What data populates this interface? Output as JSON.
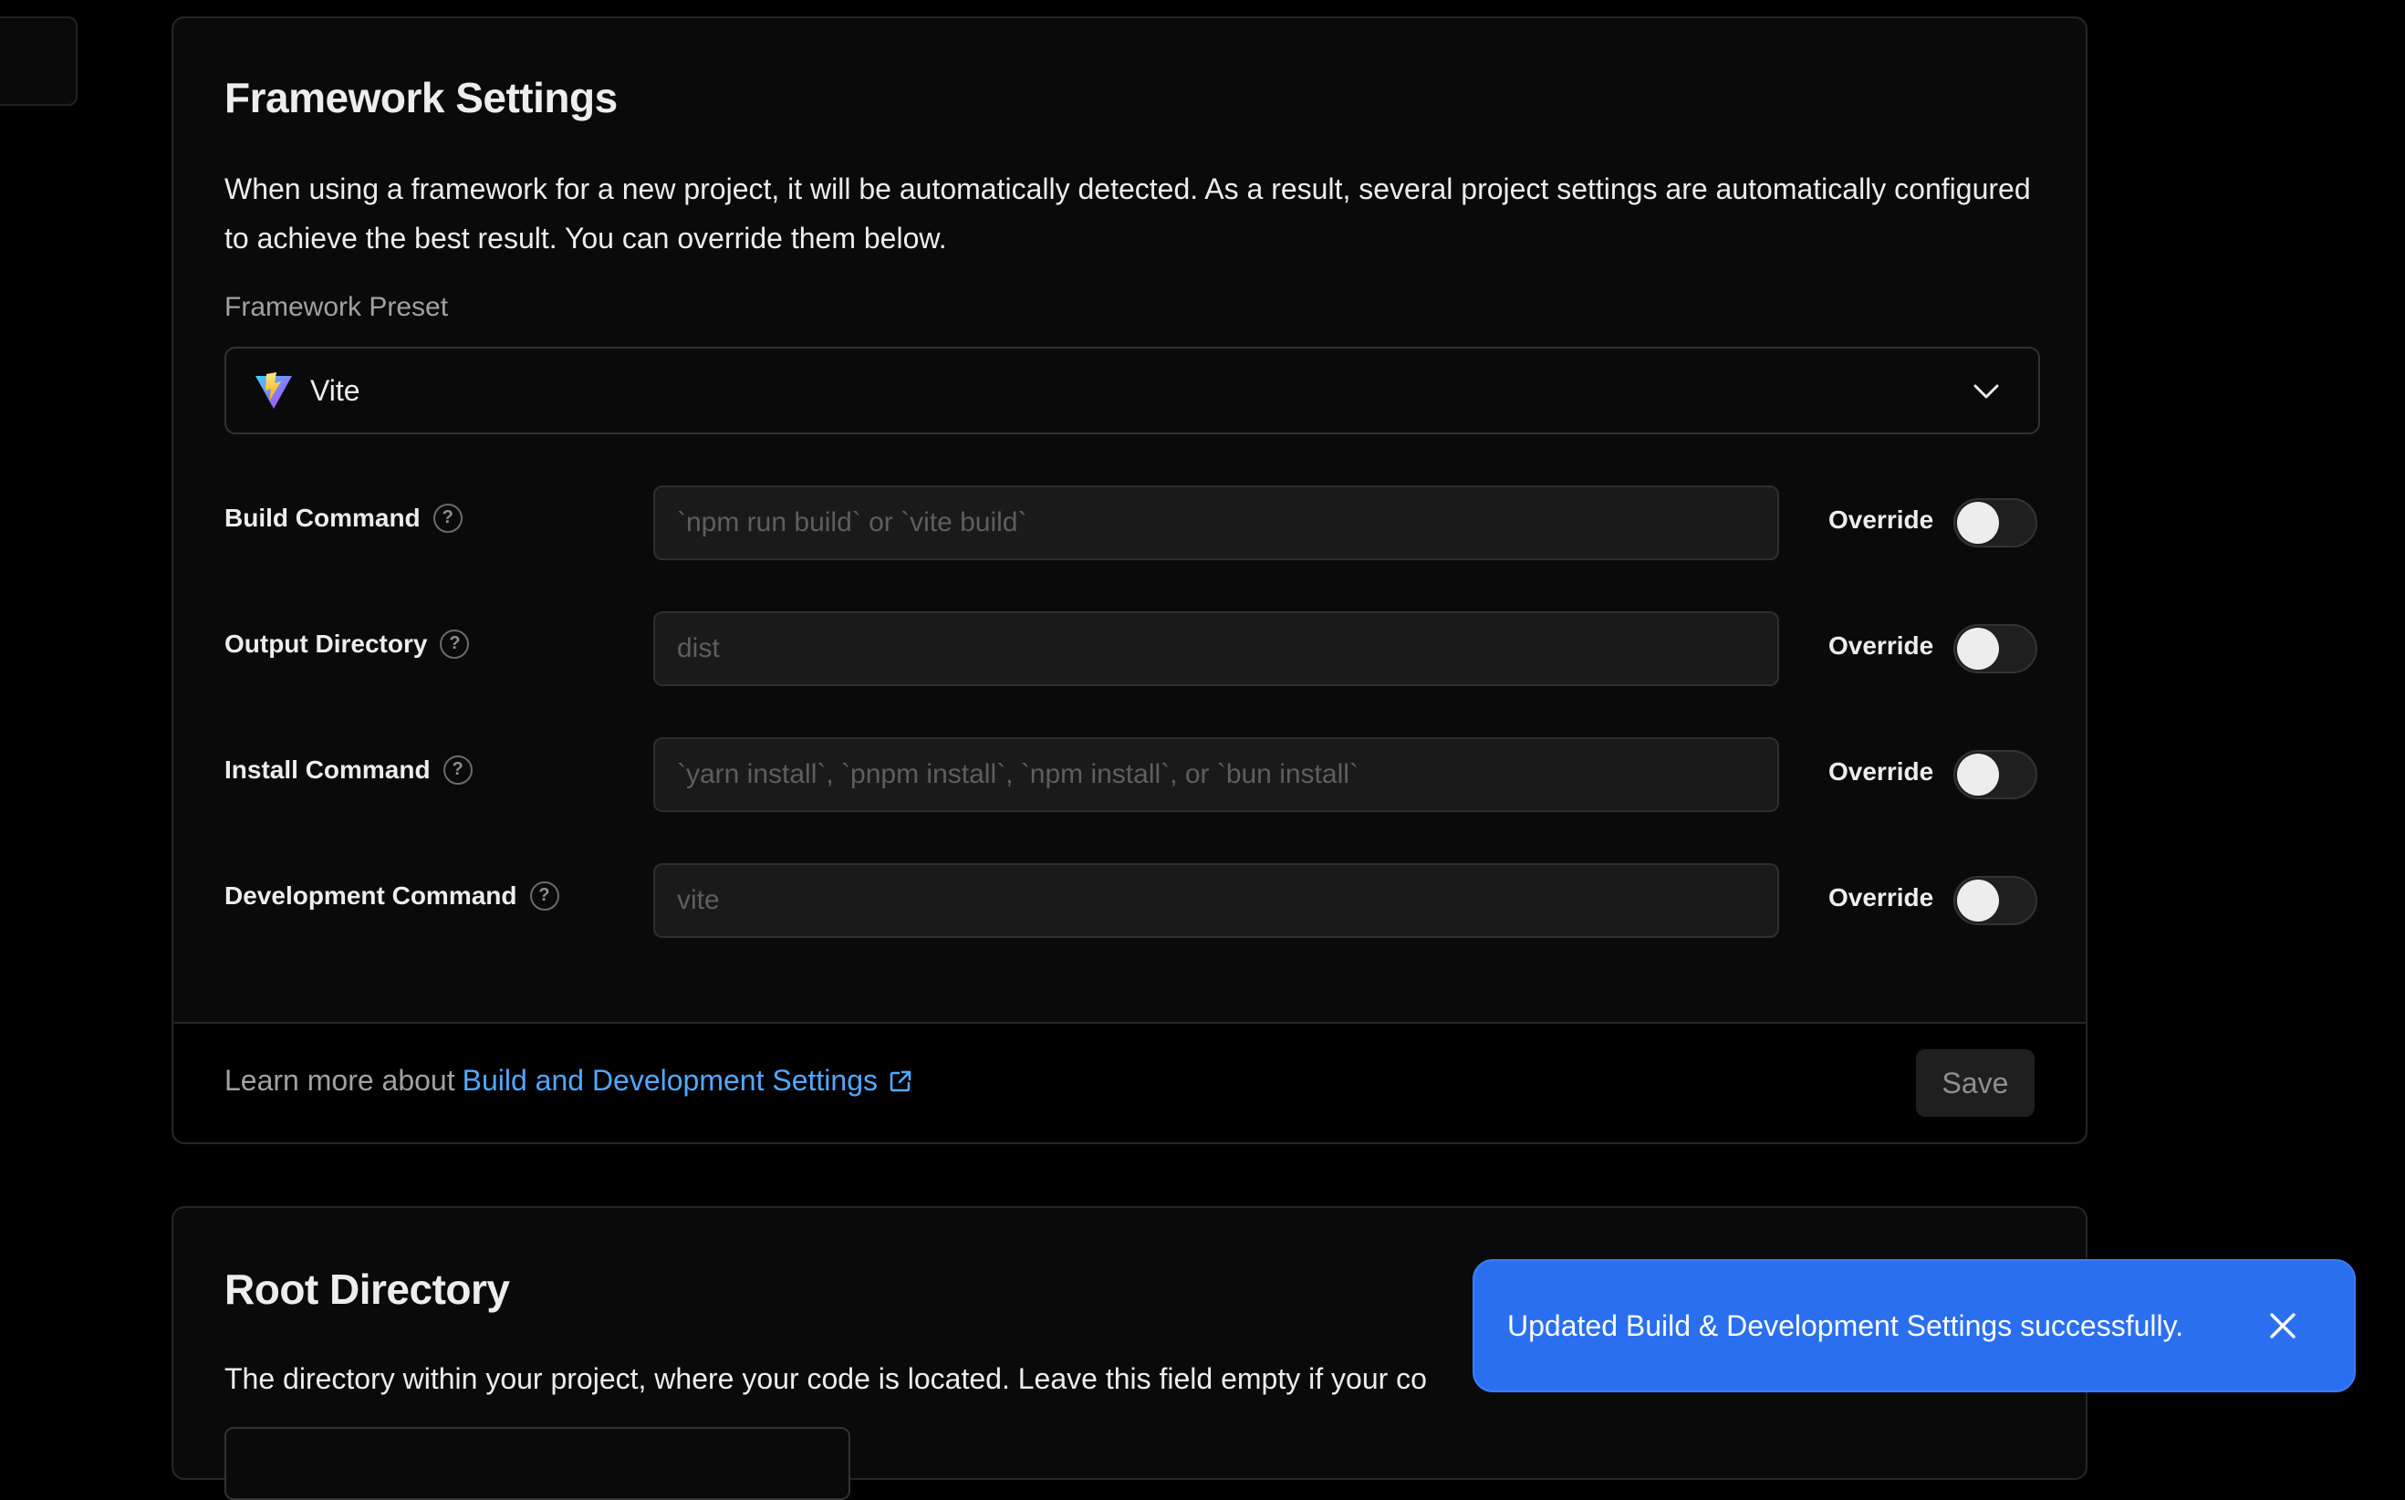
{
  "framework_settings": {
    "title": "Framework Settings",
    "description": "When using a framework for a new project, it will be automatically detected. As a result, several project settings are automatically configured to achieve the best result. You can override them below.",
    "preset": {
      "label": "Framework Preset",
      "value": "Vite",
      "icon": "vite-logo"
    },
    "rows": [
      {
        "label": "Build Command",
        "placeholder": "`npm run build` or `vite build`",
        "override_label": "Override",
        "override_on": false
      },
      {
        "label": "Output Directory",
        "placeholder": "dist",
        "override_label": "Override",
        "override_on": false
      },
      {
        "label": "Install Command",
        "placeholder": "`yarn install`, `pnpm install`, `npm install`, or `bun install`",
        "override_label": "Override",
        "override_on": false
      },
      {
        "label": "Development Command",
        "placeholder": "vite",
        "override_label": "Override",
        "override_on": false
      }
    ],
    "footer": {
      "learn_prefix": "Learn more about",
      "learn_link": "Build and Development Settings",
      "save_label": "Save"
    }
  },
  "root_directory": {
    "title": "Root Directory",
    "description": "The directory within your project, where your code is located. Leave this field empty if your co"
  },
  "toast": {
    "message": "Updated Build & Development Settings successfully.",
    "color": "#2a6ff0"
  }
}
